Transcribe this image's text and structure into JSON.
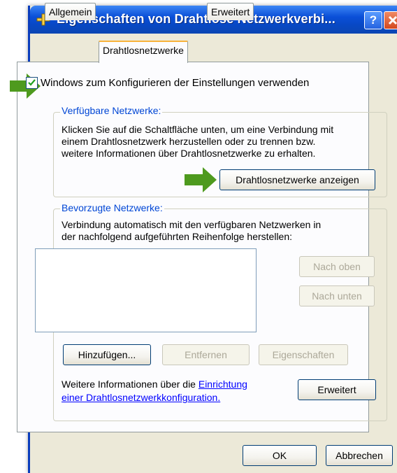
{
  "window": {
    "title": "Eigenschaften von Drahtlose Netzwerkverbi...",
    "help_label": "?"
  },
  "tabs": [
    {
      "label": "Allgemein"
    },
    {
      "label": "Drahtlosnetzwerke"
    },
    {
      "label": "Erweitert"
    }
  ],
  "active_tab_index": 1,
  "config_checkbox": {
    "label": "Windows zum Konfigurieren der Einstellungen verwenden",
    "checked": true
  },
  "available_networks": {
    "title": "Verfügbare Netzwerke:",
    "lines": [
      "Klicken Sie auf die Schaltfläche unten, um eine Verbindung mit",
      "einem Drahtlosnetzwerk herzustellen oder zu trennen bzw.",
      "weitere Informationen über Drahtlosnetzwerke zu erhalten."
    ],
    "show_button": "Drahtlosnetzwerke anzeigen"
  },
  "preferred_networks": {
    "title": "Bevorzugte Netzwerke:",
    "lines": [
      "Verbindung automatisch mit den verfügbaren Netzwerken in",
      "der nachfolgend aufgeführten Reihenfolge herstellen:"
    ],
    "move_up": "Nach oben",
    "move_down": "Nach unten",
    "add": "Hinzufügen...",
    "remove": "Entfernen",
    "properties": "Eigenschaften",
    "info_text": "Weitere Informationen über die ",
    "info_link_1": "Einrichtung",
    "info_link_2": "einer Drahtlosnetzwerkkonfiguration.",
    "advanced": "Erweitert"
  },
  "footer": {
    "ok": "OK",
    "cancel": "Abbrechen"
  },
  "colors": {
    "arrow": "#4e9a1e",
    "title_bar": "#0a4fd8",
    "group_title": "#0046d5"
  }
}
